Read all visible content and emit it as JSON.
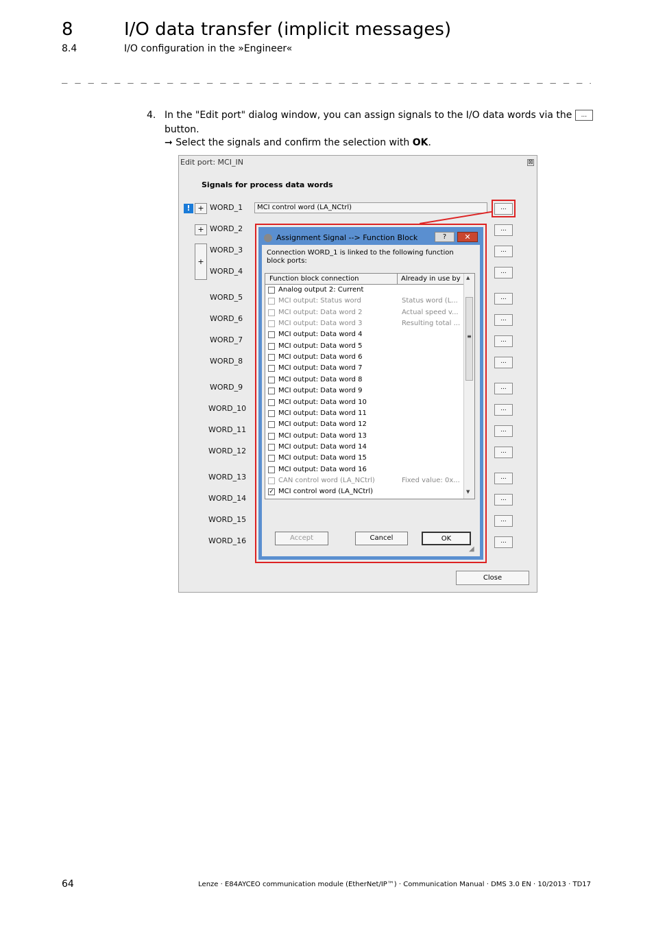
{
  "header": {
    "chapter_num": "8",
    "chapter_title": "I/O data transfer (implicit messages)",
    "section_num": "8.4",
    "section_title": "I/O configuration in the »Engineer«",
    "divider": "_ _ _ _ _ _ _ _ _ _ _ _ _ _ _ _ _ _ _ _ _ _ _ _ _ _ _ _ _ _ _ _ _ _ _ _ _ _ _ _ _ _ _ _ _ _ _ _ _ _ _ _ _ _ _ _ _ _ _ _ _ _ _ _"
  },
  "step": {
    "number": "4.",
    "text_a": "In the \"Edit port\" dialog window, you can assign signals to the I/O data words via the",
    "inline_button": "...",
    "text_b": "button.",
    "arrow": "➞",
    "result_a": "Select the signals and confirm the selection with ",
    "result_bold": "OK",
    "result_c": "."
  },
  "edit_port": {
    "title": "Edit port: MCI_IN",
    "close_glyph": "⊠",
    "heading": "Signals for process data words",
    "word1_value": "MCI control word (LA_NCtrl)",
    "warn_glyph": "!",
    "plus_glyph": "+",
    "dots": "...",
    "close_button": "Close",
    "words": [
      "WORD_1",
      "WORD_2",
      "WORD_3",
      "WORD_4",
      "WORD_5",
      "WORD_6",
      "WORD_7",
      "WORD_8",
      "WORD_9",
      "WORD_10",
      "WORD_11",
      "WORD_12",
      "WORD_13",
      "WORD_14",
      "WORD_15",
      "WORD_16"
    ]
  },
  "assign_dialog": {
    "title": "Assignment Signal --> Function Block",
    "help_glyph": "?",
    "close_glyph": "✕",
    "description": "Connection WORD_1 is linked to the following function block ports:",
    "col_connection": "Function block connection",
    "col_used_by": "Already in use by",
    "items": [
      {
        "label": "Analog output 2: Current",
        "used_by": "",
        "checked": false,
        "disabled": false
      },
      {
        "label": "MCI output: Status word",
        "used_by": "Status word (L...",
        "checked": false,
        "disabled": true
      },
      {
        "label": "MCI output: Data word 2",
        "used_by": "Actual speed v...",
        "checked": false,
        "disabled": true
      },
      {
        "label": "MCI output: Data word 3",
        "used_by": "Resulting total ...",
        "checked": false,
        "disabled": true
      },
      {
        "label": "MCI output: Data word 4",
        "used_by": "",
        "checked": false,
        "disabled": false
      },
      {
        "label": "MCI output: Data word 5",
        "used_by": "",
        "checked": false,
        "disabled": false
      },
      {
        "label": "MCI output: Data word 6",
        "used_by": "",
        "checked": false,
        "disabled": false
      },
      {
        "label": "MCI output: Data word 7",
        "used_by": "",
        "checked": false,
        "disabled": false
      },
      {
        "label": "MCI output: Data word 8",
        "used_by": "",
        "checked": false,
        "disabled": false
      },
      {
        "label": "MCI output: Data word 9",
        "used_by": "",
        "checked": false,
        "disabled": false
      },
      {
        "label": "MCI output: Data word 10",
        "used_by": "",
        "checked": false,
        "disabled": false
      },
      {
        "label": "MCI output: Data word 11",
        "used_by": "",
        "checked": false,
        "disabled": false
      },
      {
        "label": "MCI output: Data word 12",
        "used_by": "",
        "checked": false,
        "disabled": false
      },
      {
        "label": "MCI output: Data word 13",
        "used_by": "",
        "checked": false,
        "disabled": false
      },
      {
        "label": "MCI output: Data word 14",
        "used_by": "",
        "checked": false,
        "disabled": false
      },
      {
        "label": "MCI output: Data word 15",
        "used_by": "",
        "checked": false,
        "disabled": false
      },
      {
        "label": "MCI output: Data word 16",
        "used_by": "",
        "checked": false,
        "disabled": false
      },
      {
        "label": "CAN control word (LA_NCtrl)",
        "used_by": "Fixed value: 0x...",
        "checked": false,
        "disabled": true
      },
      {
        "label": "MCI control word (LA_NCtrl)",
        "used_by": "",
        "checked": true,
        "disabled": false
      }
    ],
    "scroll_mid": "≡",
    "accept_button": "Accept",
    "cancel_button": "Cancel",
    "ok_button": "OK"
  },
  "footer": {
    "page_number": "64",
    "doc_line": "Lenze · E84AYCEO communication module (EtherNet/IP™) · Communication Manual · DMS 3.0 EN · 10/2013 · TD17"
  }
}
